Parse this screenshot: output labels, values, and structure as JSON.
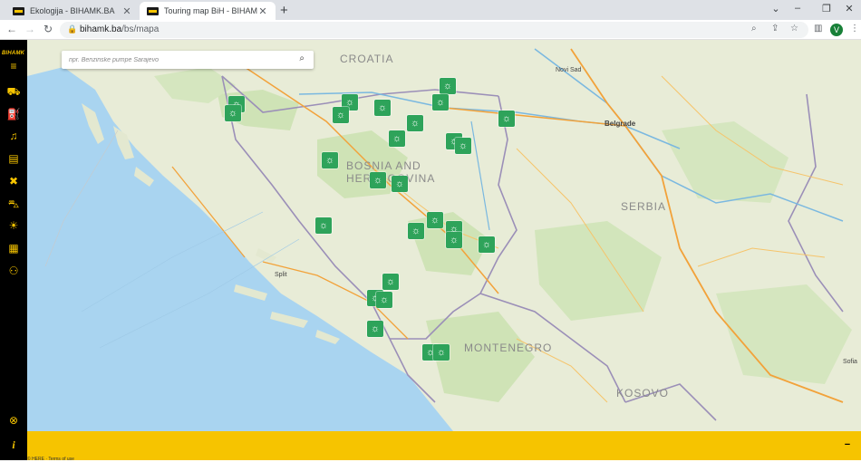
{
  "tabs": [
    {
      "label": "Ekologija - BIHAMK.BA"
    },
    {
      "label": "Touring map BiH - BIHAMK.BA"
    }
  ],
  "address": {
    "domain": "bihamk.ba",
    "path": "/bs/mapa"
  },
  "profile_initial": "V",
  "sidebar": {
    "brand": "BIHAMK"
  },
  "search": {
    "placeholder": "npr. Benzinske pumpe Sarajevo"
  },
  "map": {
    "countries": [
      "CROATIA",
      "BOSNIA AND",
      "HERZEGOVINA",
      "SERBIA",
      "MONTENEGRO",
      "KOSOVO"
    ],
    "cities": [
      "Novi Sad",
      "Belgrade",
      "Split",
      "Sofia"
    ]
  },
  "attribution": "© HERE · Terms of use",
  "colors": {
    "brand": "#f6c400",
    "marker": "#2ea35a",
    "sidebar": "#000000"
  }
}
